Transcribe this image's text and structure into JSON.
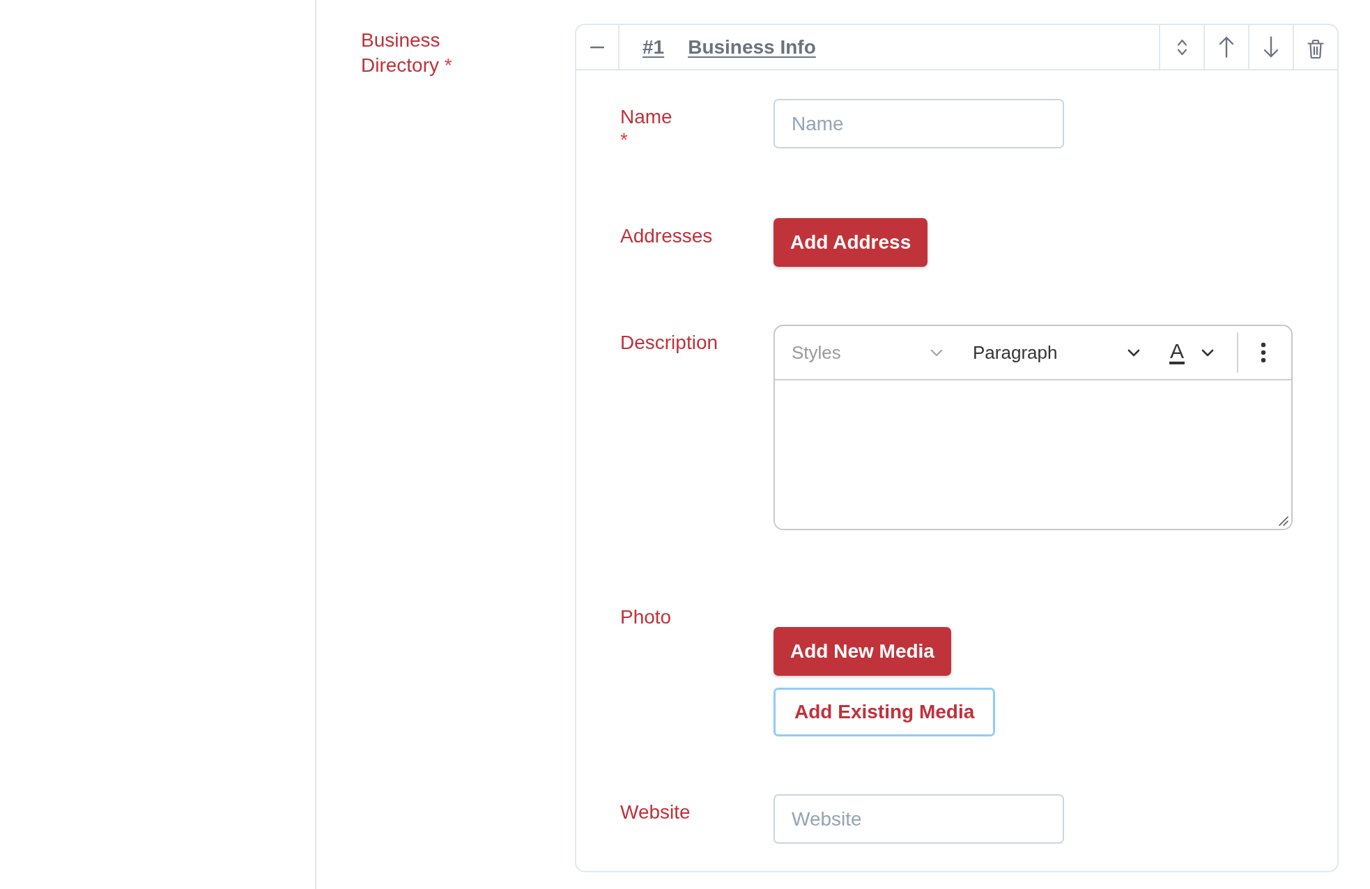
{
  "group": {
    "label": "Business Directory",
    "required_mark": "*"
  },
  "block": {
    "index": "#1",
    "title": "Business Info",
    "expanded": true
  },
  "fields": [
    {
      "kind": "text",
      "label": "Name",
      "required_mark": "*",
      "placeholder": "Name"
    },
    {
      "kind": "buttons",
      "label": "Addresses",
      "buttons": [
        {
          "label": "Add Address",
          "kind": "primary",
          "focused": false
        }
      ]
    },
    {
      "kind": "richtext",
      "label": "Description",
      "toolbar": {
        "styles": {
          "label": "Styles",
          "disabled": true
        },
        "format": {
          "label": "Paragraph",
          "disabled": false
        },
        "text_color": {
          "glyph": "A"
        }
      }
    },
    {
      "kind": "media",
      "label": "Photo",
      "buttons": [
        {
          "label": "Add New Media",
          "kind": "primary",
          "focused": false
        },
        {
          "label": "Add Existing Media",
          "kind": "secondary",
          "focused": true
        }
      ]
    },
    {
      "kind": "text",
      "label": "Website",
      "placeholder": "Website"
    }
  ]
}
